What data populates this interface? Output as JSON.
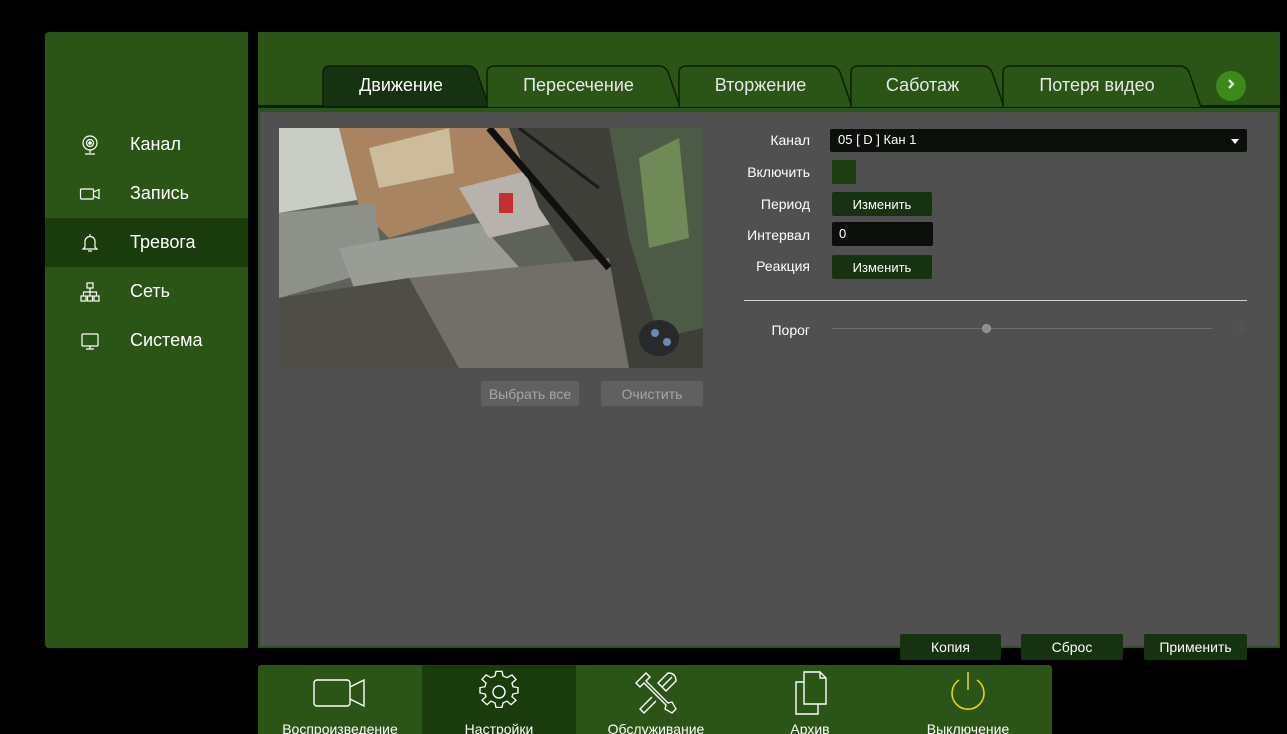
{
  "sidebar": {
    "items": [
      {
        "label": "Канал",
        "icon": "webcam-icon"
      },
      {
        "label": "Запись",
        "icon": "camcorder-icon"
      },
      {
        "label": "Тревога",
        "icon": "bell-icon",
        "active": true
      },
      {
        "label": "Сеть",
        "icon": "network-icon"
      },
      {
        "label": "Система",
        "icon": "monitor-icon"
      }
    ]
  },
  "tabs": [
    {
      "label": "Движение",
      "active": true
    },
    {
      "label": "Пересечение"
    },
    {
      "label": "Вторжение"
    },
    {
      "label": "Саботаж"
    },
    {
      "label": "Потеря видео"
    }
  ],
  "preview": {
    "select_all": "Выбрать все",
    "clear": "Очистить"
  },
  "form": {
    "channel_label": "Канал",
    "channel_value": "05 [ D ] Кан 1",
    "enable_label": "Включить",
    "period_label": "Период",
    "period_button": "Изменить",
    "interval_label": "Интервал",
    "interval_value": "0",
    "reaction_label": "Реакция",
    "reaction_button": "Изменить",
    "threshold_label": "Порог",
    "threshold_value": "3"
  },
  "actions": {
    "copy": "Копия",
    "reset": "Сброс",
    "apply": "Применить"
  },
  "toolbar": {
    "items": [
      {
        "label": "Воспроизведение",
        "icon": "camera-icon"
      },
      {
        "label": "Настройки",
        "icon": "gear-icon",
        "active": true
      },
      {
        "label": "Обслуживание",
        "icon": "tools-icon"
      },
      {
        "label": "Архив",
        "icon": "files-icon"
      },
      {
        "label": "Выключение",
        "icon": "power-icon"
      }
    ]
  },
  "colors": {
    "panel_green": "#2b5517",
    "active_green": "#1a3b0b",
    "content_gray": "#505050",
    "power_yellow": "#e8d21a"
  }
}
